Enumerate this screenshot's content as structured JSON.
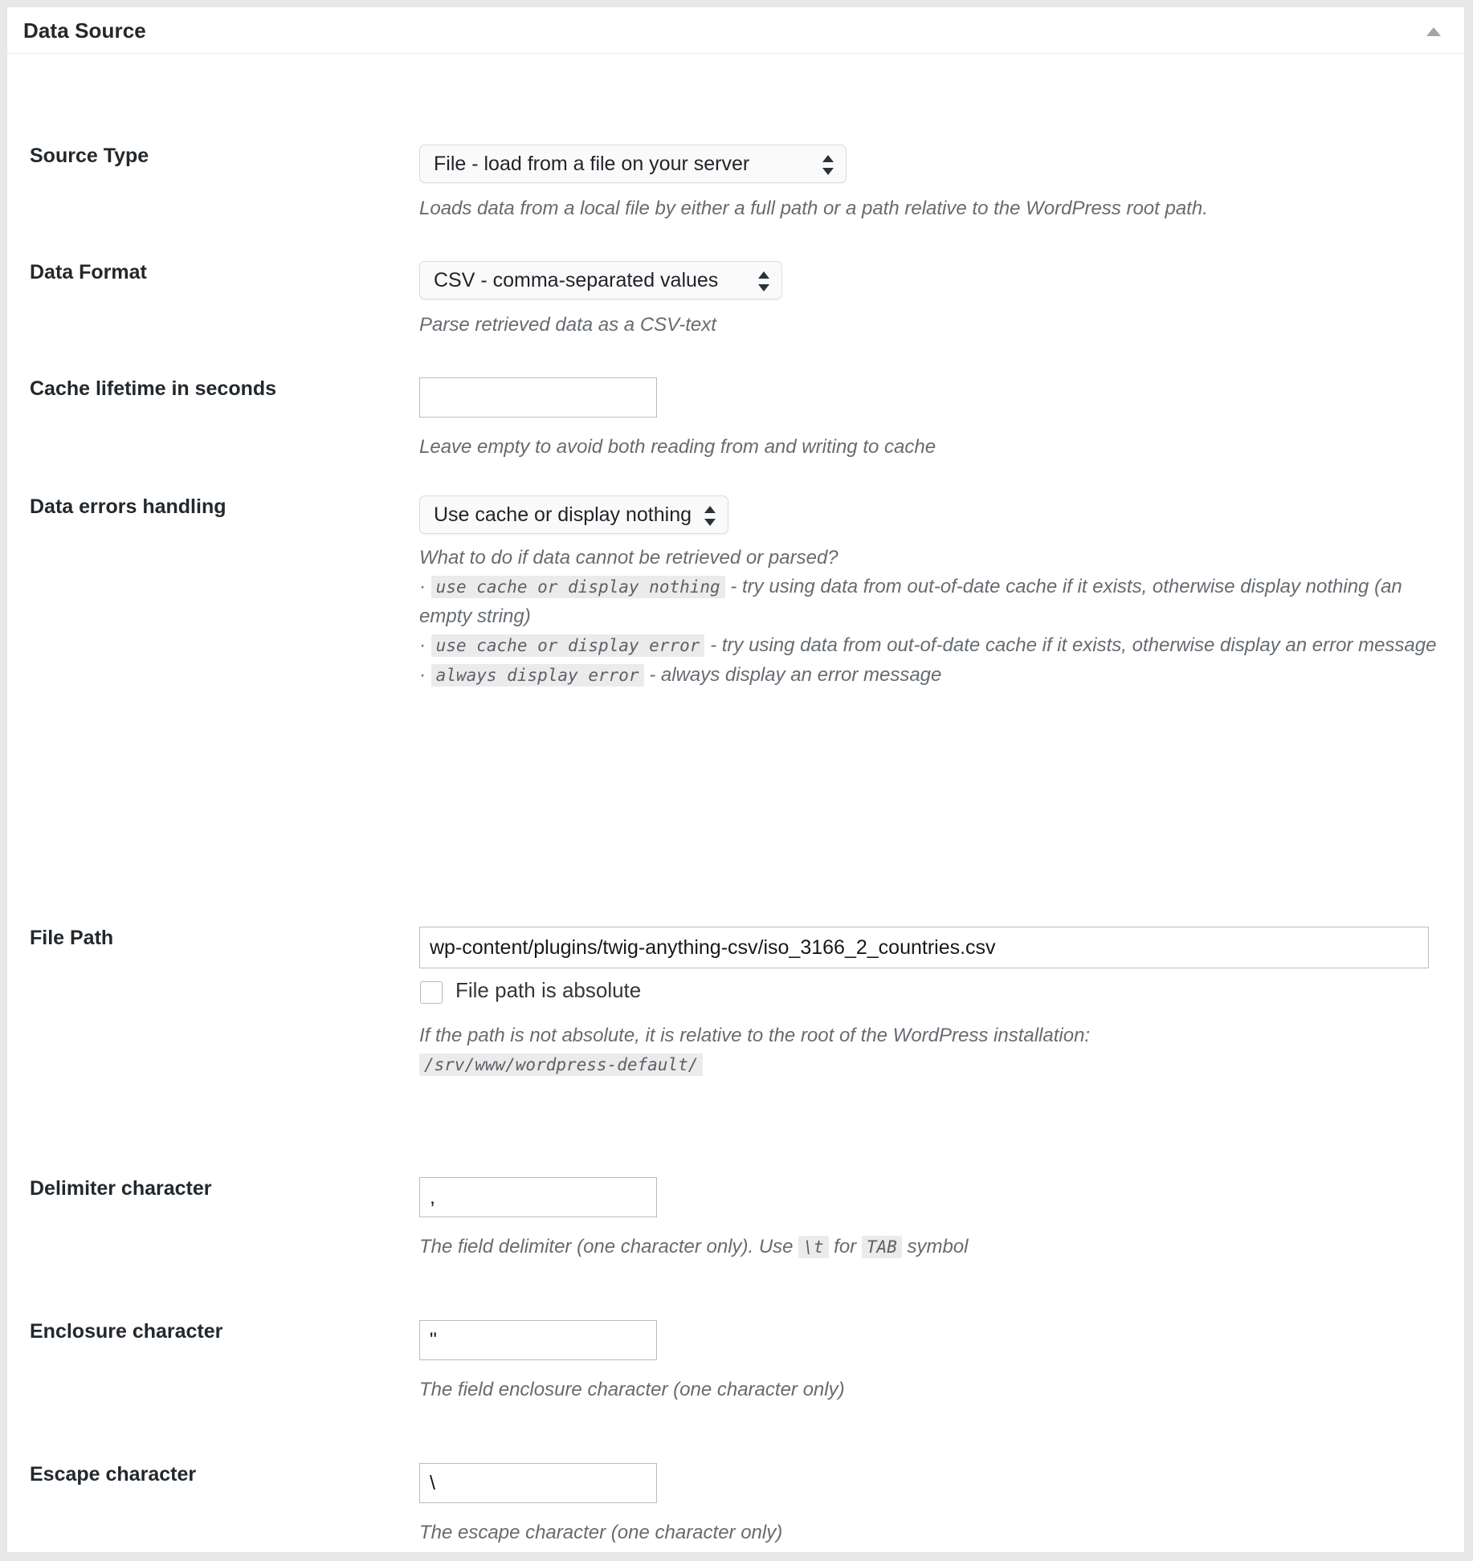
{
  "panel": {
    "title": "Data Source",
    "collapse_icon": "triangle-up-icon"
  },
  "fields": {
    "source_type": {
      "label": "Source Type",
      "value": "File - load from a file on your server",
      "help": "Loads data from a local file by either a full path or a path relative to the WordPress root path."
    },
    "data_format": {
      "label": "Data Format",
      "value": "CSV - comma-separated values",
      "help": "Parse retrieved data as a CSV-text"
    },
    "cache_lifetime": {
      "label": "Cache lifetime in seconds",
      "value": "",
      "placeholder": "",
      "help": "Leave empty to avoid both reading from and writing to cache"
    },
    "data_errors_handling": {
      "label": "Data errors handling",
      "value": "Use cache or display nothing",
      "help_intro": "What to do if data cannot be retrieved or parsed?",
      "bullets": [
        {
          "marker": "·",
          "code": "use cache or display nothing",
          "text": " - try using data from out-of-date cache if it exists, otherwise display nothing (an empty string)"
        },
        {
          "marker": "·",
          "code": "use cache or display error",
          "text": " - try using data from out-of-date cache if it exists, otherwise display an error message"
        },
        {
          "marker": "·",
          "code": "always display error",
          "text": " - always display an error message"
        }
      ]
    },
    "file_path": {
      "label": "File Path",
      "value": "wp-content/plugins/twig-anything-csv/iso_3166_2_countries.csv",
      "placeholder": "",
      "checkbox_label": "File path is absolute",
      "checkbox_checked": false,
      "help_prefix": "If the path is not absolute, it is relative to the root of the WordPress installation: ",
      "help_code": "/srv/www/wordpress-default/"
    },
    "delimiter": {
      "label": "Delimiter character",
      "value": ",",
      "help_part1": "The field delimiter (one character only). Use ",
      "help_code1": "\\t",
      "help_part2": " for ",
      "help_code2": "TAB",
      "help_part3": " symbol"
    },
    "enclosure": {
      "label": "Enclosure character",
      "value": "\"",
      "help": "The field enclosure character (one character only)"
    },
    "escape": {
      "label": "Escape character",
      "value": "\\",
      "help": "The escape character (one character only)"
    }
  }
}
